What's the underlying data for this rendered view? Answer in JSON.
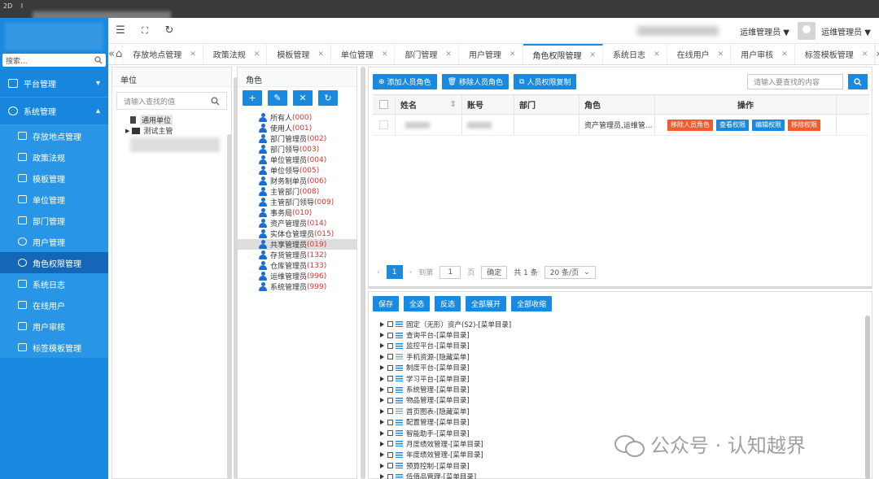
{
  "window": {
    "top_left_text": "2D",
    "top_text2": "I"
  },
  "sidebar": {
    "search_placeholder": "搜索...",
    "groups": [
      {
        "label": "平台管理"
      },
      {
        "label": "系统管理"
      }
    ],
    "items": [
      {
        "label": "存放地点管理"
      },
      {
        "label": "政策法规"
      },
      {
        "label": "模板管理"
      },
      {
        "label": "单位管理"
      },
      {
        "label": "部门管理"
      },
      {
        "label": "用户管理"
      },
      {
        "label": "角色权限管理"
      },
      {
        "label": "系统日志"
      },
      {
        "label": "在线用户"
      },
      {
        "label": "用户审核"
      },
      {
        "label": "标签模板管理"
      }
    ]
  },
  "header": {
    "role_dropdown": "运维管理员",
    "user_name": "运维管理员"
  },
  "tabs": [
    {
      "label": "存放地点管理"
    },
    {
      "label": "政策法规"
    },
    {
      "label": "模板管理"
    },
    {
      "label": "单位管理"
    },
    {
      "label": "部门管理"
    },
    {
      "label": "用户管理"
    },
    {
      "label": "角色权限管理"
    },
    {
      "label": "系统日志"
    },
    {
      "label": "在线用户"
    },
    {
      "label": "用户审核"
    },
    {
      "label": "标签模板管理"
    }
  ],
  "unit_panel": {
    "title": "单位",
    "search_placeholder": "请输入查找的值",
    "tree": [
      {
        "label": "通用单位"
      },
      {
        "label": "测试主管"
      }
    ]
  },
  "role_panel": {
    "title": "角色",
    "roles": [
      {
        "name": "所有人",
        "code": "(000)"
      },
      {
        "name": "使用人",
        "code": "(001)"
      },
      {
        "name": "部门管理员",
        "code": "(002)"
      },
      {
        "name": "部门领导",
        "code": "(003)"
      },
      {
        "name": "单位管理员",
        "code": "(004)"
      },
      {
        "name": "单位领导",
        "code": "(005)"
      },
      {
        "name": "财务制单员",
        "code": "(006)"
      },
      {
        "name": "主管部门",
        "code": "(008)"
      },
      {
        "name": "主管部门领导",
        "code": "(009)"
      },
      {
        "name": "事务局",
        "code": "(010)"
      },
      {
        "name": "资产管理员",
        "code": "(014)"
      },
      {
        "name": "实体仓管理员",
        "code": "(015)"
      },
      {
        "name": "共享管理员",
        "code": "(019)"
      },
      {
        "name": "存货管理员",
        "code": "(132)"
      },
      {
        "name": "仓库管理员",
        "code": "(133)"
      },
      {
        "name": "运维管理员",
        "code": "(996)"
      },
      {
        "name": "系统管理员",
        "code": "(999)"
      }
    ]
  },
  "user_grid": {
    "add_btn": "添加人员角色",
    "remove_btn": "移除人员角色",
    "copy_btn": "人员权限复制",
    "search_placeholder": "请输入要查找的内容",
    "columns": {
      "name": "姓名",
      "account": "账号",
      "dept": "部门",
      "role": "角色",
      "ops": "操作"
    },
    "rows": [
      {
        "role": "资产管理员,运维管..."
      }
    ],
    "actions": {
      "remove": "移除人员角色",
      "view": "查看权限",
      "edit": "编辑权限",
      "delete": "移除权限"
    },
    "pager": {
      "current": "1",
      "goto_label": "到第",
      "page_input": "1",
      "page_unit": "页",
      "confirm": "确定",
      "total": "共 1 条",
      "per_page": "20 条/页"
    }
  },
  "perm_tree": {
    "buttons": {
      "save": "保存",
      "select_all": "全选",
      "invert": "反选",
      "expand": "全部展开",
      "collapse": "全部收缩"
    },
    "menus": [
      {
        "label": "固定（无形）资产(S2)-[菜单目录]",
        "hidden": false
      },
      {
        "label": "查询平台-[菜单目录]",
        "hidden": false
      },
      {
        "label": "监控平台-[菜单目录]",
        "hidden": false
      },
      {
        "label": "手机资源-[隐藏菜单]",
        "hidden": true
      },
      {
        "label": "制度平台-[菜单目录]",
        "hidden": false
      },
      {
        "label": "学习平台-[菜单目录]",
        "hidden": false
      },
      {
        "label": "系统管理-[菜单目录]",
        "hidden": false
      },
      {
        "label": "物品管理-[菜单目录]",
        "hidden": false
      },
      {
        "label": "首页图表-[隐藏菜单]",
        "hidden": true
      },
      {
        "label": "配置管理-[菜单目录]",
        "hidden": false
      },
      {
        "label": "智能助手-[菜单目录]",
        "hidden": false
      },
      {
        "label": "月度绩效管理-[菜单目录]",
        "hidden": false
      },
      {
        "label": "年度绩效管理-[菜单目录]",
        "hidden": false
      },
      {
        "label": "预算控制-[菜单目录]",
        "hidden": false
      },
      {
        "label": "低值品管理-[菜单目录]",
        "hidden": false
      }
    ]
  },
  "watermark": {
    "text": "公众号 · 认知越界"
  },
  "colors": {
    "primary": "#1a8ae0",
    "danger": "#f25b2b",
    "sidebar_active": "#1467b8"
  }
}
